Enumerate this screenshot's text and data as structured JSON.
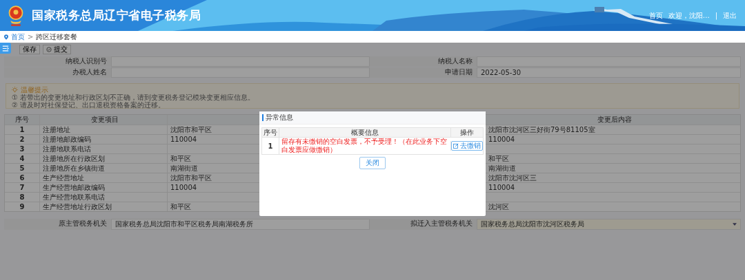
{
  "header": {
    "title": "国家税务总局辽宁省电子税务局",
    "links": [
      "首页",
      "欢迎，沈阳…",
      "退出"
    ],
    "separator": "|"
  },
  "breadcrumb": {
    "home": "首页",
    "separator": ">",
    "current": "跨区迁移套餐"
  },
  "toolbar": [
    "保存",
    "提交"
  ],
  "form": [
    {
      "label": "纳税人识别号"
    },
    {
      "label": "纳税人名称"
    },
    {
      "label": "办税人姓名"
    },
    {
      "label": "申请日期",
      "value": "2022-05-30"
    }
  ],
  "tips": {
    "title": "温馨提示",
    "lines": [
      "① 若带出的变更地址和行政区划不正确，请到变更税务登记模块变更相应信息。",
      "② 请及时对社保登记、出口退税资格备案的迁移。"
    ]
  },
  "table": {
    "columns": [
      "序号",
      "变更项目",
      "变更后内容"
    ],
    "rows": [
      {
        "no": "1",
        "item": "注册地址",
        "before": "沈阳市和平区",
        "after": "沈阳市沈河区三好街79号81105室"
      },
      {
        "no": "2",
        "item": "注册地邮政编码",
        "before": "110004",
        "after": "110004"
      },
      {
        "no": "3",
        "item": "注册地联系电话"
      },
      {
        "no": "4",
        "item": "注册地所在行政区划",
        "before": "和平区",
        "after": "和平区"
      },
      {
        "no": "5",
        "item": "注册地所在乡镇街道",
        "before": "南湖街道",
        "after": "南湖街道"
      },
      {
        "no": "6",
        "item": "生产经营地址",
        "before": "沈阳市和平区",
        "after": "沈阳市沈河区三"
      },
      {
        "no": "7",
        "item": "生产经营地邮政编码",
        "before": "110004",
        "after": "110004"
      },
      {
        "no": "8",
        "item": "生产经营地联系电话"
      },
      {
        "no": "9",
        "item": "生产经营地址行政区划",
        "before": "和平区",
        "after": "沈河区"
      }
    ]
  },
  "offices": [
    {
      "label": "原主管税务机关",
      "value": "国家税务总局沈阳市和平区税务局南湖税务所",
      "kind": "text"
    },
    {
      "label": "拟迁入主管税务机关",
      "value": "国家税务总局沈阳市沈河区税务局",
      "kind": "select"
    }
  ],
  "dialog": {
    "title": "异常信息",
    "columns": [
      "序号",
      "概要信息",
      "操作"
    ],
    "rows": [
      {
        "no": "1",
        "message": "留存有未缴销的空白发票，不予受理！（在此业务下空白发票应做缴销）",
        "action": "去缴销"
      }
    ],
    "close": "关闭"
  }
}
